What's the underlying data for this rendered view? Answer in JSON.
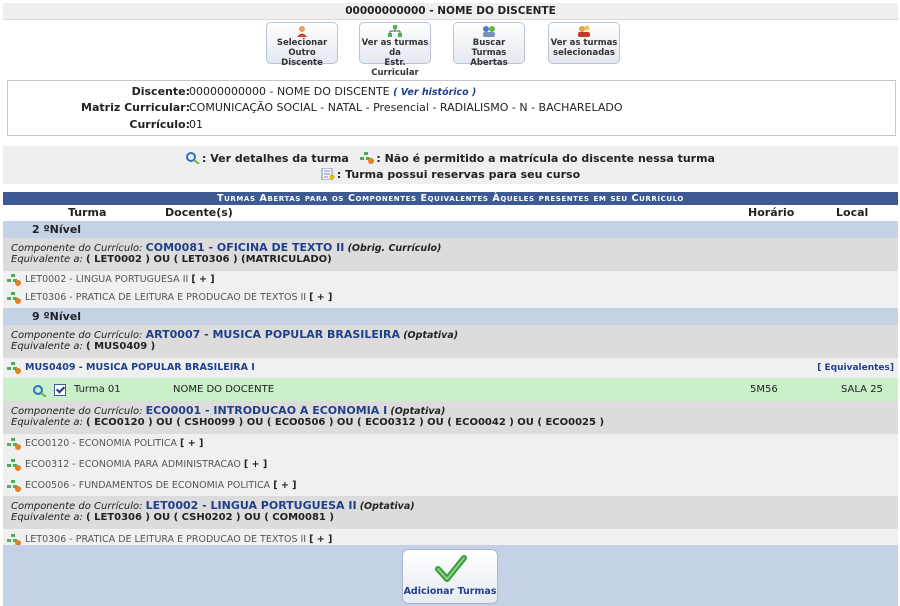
{
  "header": {
    "title": "00000000000 - NOME DO DISCENTE"
  },
  "toolbar": [
    {
      "line1": "Selecionar Outro",
      "line2": "Discente",
      "icon": "user-icon"
    },
    {
      "line1": "Ver as turmas da",
      "line2": "Estr. Curricular",
      "icon": "tree-icon"
    },
    {
      "line1": "Buscar Turmas",
      "line2": "Abertas",
      "icon": "group-search-icon"
    },
    {
      "line1": "Ver as turmas",
      "line2": "selecionadas",
      "icon": "group-icon"
    }
  ],
  "info": {
    "discente_label": "Discente:",
    "discente_value": "00000000000 - NOME DO DISCENTE",
    "historico_link": "( Ver histórico )",
    "matriz_label": "Matriz Curricular:",
    "matriz_value": "COMUNICAÇÃO SOCIAL - NATAL - Presencial - RADIALISMO - N - BACHARELADO",
    "curriculo_label": "Currículo:",
    "curriculo_value": "01"
  },
  "legend": {
    "detalhes": ": Ver detalhes da turma",
    "nao_permitido": ": Não é permitido a matrícula do discente nessa turma",
    "reservas": ": Turma possui reservas para seu curso"
  },
  "table": {
    "caption": "Turmas Abertas para os Componentes Equivalentes Àqueles presentes em seu Currículo",
    "headers": {
      "turma": "Turma",
      "docente": "Docente(s)",
      "horario": "Horário",
      "local": "Local"
    },
    "nivel2": "2 ºNível",
    "nivel9": "9 ºNível",
    "comp_label": "Componente do Currículo: ",
    "eq_label": "Equivalente a: ",
    "components": [
      {
        "code": "COM0081 - OFICINA DE TEXTO II",
        "obs": "(Obrig. Currículo)",
        "equiv": "( LET0002 ) OU ( LET0306 ) (MATRICULADO)"
      },
      {
        "code": "ART0007 - MUSICA POPULAR BRASILEIRA",
        "obs": "(Optativa)",
        "equiv": "( MUS0409 )"
      },
      {
        "code": "ECO0001 - INTRODUCAO A ECONOMIA I",
        "obs": "(Optativa)",
        "equiv": "( ECO0120 ) OU ( CSH0099 ) OU ( ECO0506 ) OU ( ECO0312 ) OU ( ECO0042 ) OU ( ECO0025 )"
      },
      {
        "code": "LET0002 - LINGUA PORTUGUESA II",
        "obs": "(Optativa)",
        "equiv": "( LET0306 ) OU ( CSH0202 ) OU ( COM0081 )"
      }
    ],
    "disciplinas": [
      {
        "name": "LET0002 - LINGUA PORTUGUESA II",
        "plus": "[ + ]"
      },
      {
        "name": "LET0306 - PRATICA DE LEITURA E PRODUCAO DE TEXTOS II",
        "plus": "[ + ]"
      },
      {
        "name": "MUS0409 - MUSICA POPULAR BRASILEIRA I",
        "equiv": "[ Equivalentes]"
      },
      {
        "name": "ECO0120 - ECONOMIA POLITICA",
        "plus": "[ + ]"
      },
      {
        "name": "ECO0312 - ECONOMIA PARA ADMINISTRACAO",
        "plus": "[ + ]"
      },
      {
        "name": "ECO0506 - FUNDAMENTOS DE ECONOMIA POLITICA",
        "plus": "[ + ]"
      },
      {
        "name": "LET0306 - PRATICA DE LEITURA E PRODUCAO DE TEXTOS II",
        "plus": "[ + ]"
      }
    ],
    "turma_row": {
      "turma": "Turma 01",
      "docente": "NOME DO DOCENTE",
      "horario": "5M56",
      "local": "SALA 25"
    }
  },
  "footer": {
    "add_label": "Adicionar Turmas"
  },
  "colors": {
    "caption_bg": "#3d5a94",
    "nivel_bg": "#c5d2e6",
    "turma_bg": "#c9f0c9",
    "link": "#1f3f8a"
  }
}
